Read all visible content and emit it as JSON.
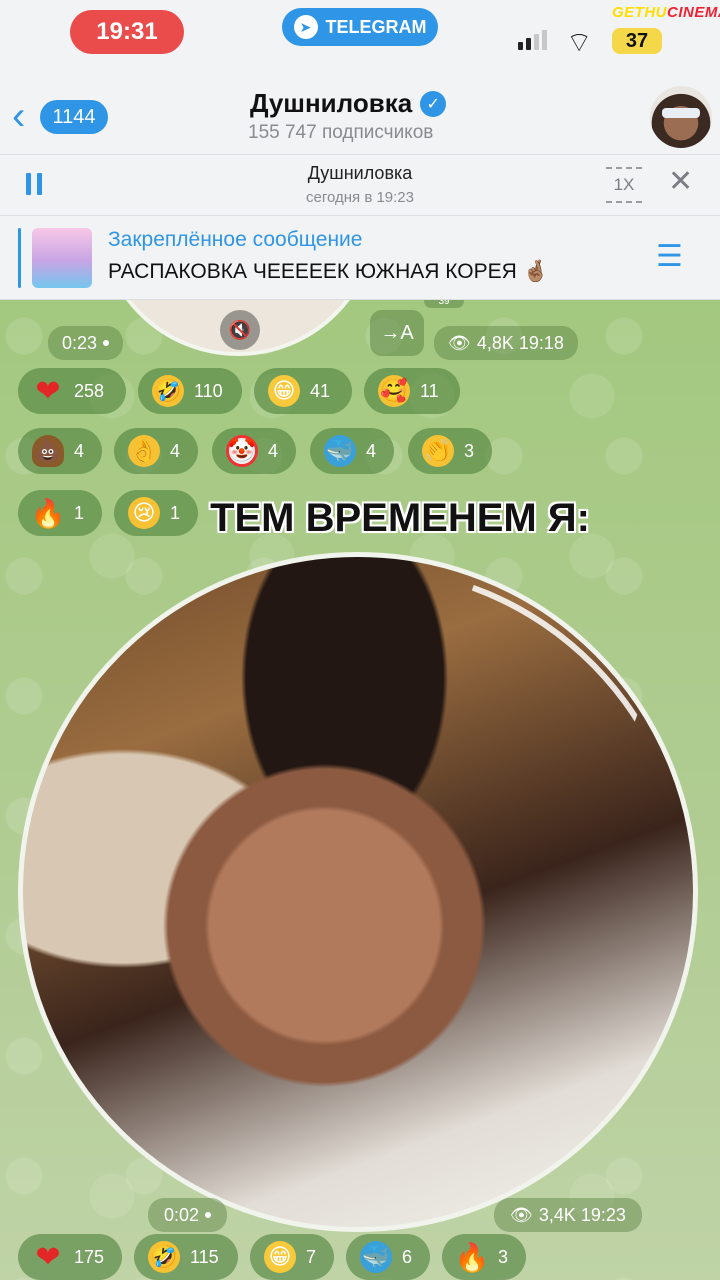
{
  "status": {
    "time": "19:31",
    "app_pill": "TELEGRAM",
    "battery": "37",
    "watermark_a": "GETHU",
    "watermark_b": "CINEMA"
  },
  "header": {
    "back_count": "1144",
    "channel_name": "Душниловка",
    "subscribers": "155 747 подписчиков"
  },
  "player": {
    "title": "Душниловка",
    "subtitle": "сегодня в 19:23",
    "speed": "1X"
  },
  "pinned": {
    "label": "Закреплённое сообщение",
    "text": "РАСПАКОВКА ЧЕЕЕЕЕК ЮЖНАЯ КОРЕЯ 🤞🏽"
  },
  "message1": {
    "duration": "0:23",
    "views_time": "4,8K 19:18",
    "translate": "→A",
    "peek": "39",
    "reactions": [
      {
        "emoji": "❤",
        "count": "258"
      },
      {
        "emoji": "🤣",
        "count": "110"
      },
      {
        "emoji": "😁",
        "count": "41"
      },
      {
        "emoji": "🥰",
        "count": "11"
      },
      {
        "emoji": "💩",
        "count": "4"
      },
      {
        "emoji": "👌",
        "count": "4"
      },
      {
        "emoji": "🤡",
        "count": "4"
      },
      {
        "emoji": "🐳",
        "count": "4"
      },
      {
        "emoji": "👏",
        "count": "3"
      },
      {
        "emoji": "🔥",
        "count": "1"
      },
      {
        "emoji": "😢",
        "count": "1"
      }
    ]
  },
  "overlay_caption": "ТЕМ ВРЕМЕНЕМ Я:",
  "message2": {
    "duration": "0:02",
    "views_time": "3,4K 19:23",
    "reactions": [
      {
        "emoji": "❤",
        "count": "175"
      },
      {
        "emoji": "🤣",
        "count": "115"
      },
      {
        "emoji": "😁",
        "count": "7"
      },
      {
        "emoji": "🐳",
        "count": "6"
      },
      {
        "emoji": "🔥",
        "count": "3"
      }
    ]
  },
  "colors": {
    "accent": "#2f95e6",
    "time_pill": "#ea4b4b",
    "battery": "#f5d84a",
    "chat_bg": "#a7c88a",
    "reaction_bg": "#4c803a"
  }
}
